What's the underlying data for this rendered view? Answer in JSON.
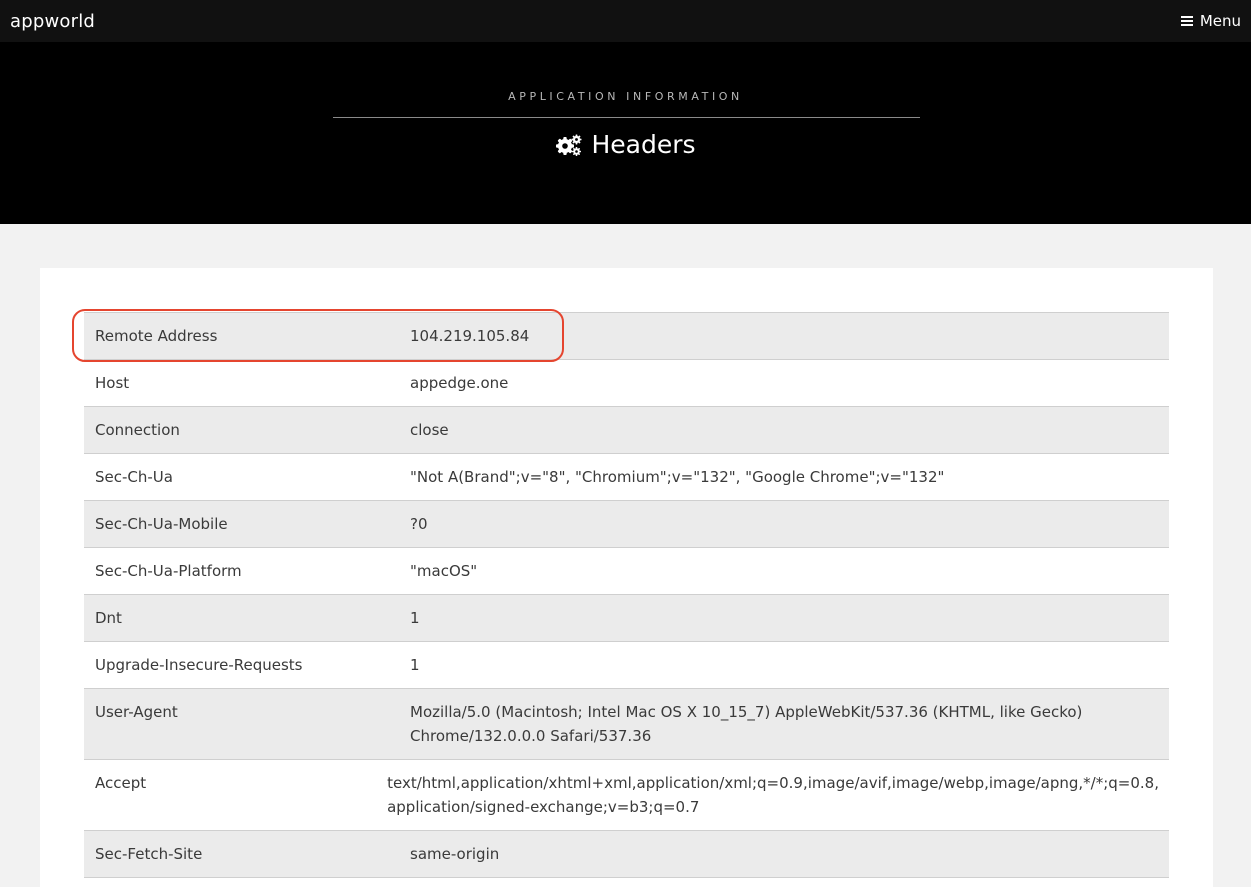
{
  "topbar": {
    "logo": "appworld",
    "menu_label": "Menu"
  },
  "hero": {
    "eyebrow": "APPLICATION INFORMATION",
    "title": "Headers"
  },
  "headers": [
    {
      "key": "Remote Address",
      "value": "104.219.105.84"
    },
    {
      "key": "Host",
      "value": "appedge.one"
    },
    {
      "key": "Connection",
      "value": "close"
    },
    {
      "key": "Sec-Ch-Ua",
      "value": "\"Not A(Brand\";v=\"8\", \"Chromium\";v=\"132\", \"Google Chrome\";v=\"132\""
    },
    {
      "key": "Sec-Ch-Ua-Mobile",
      "value": "?0"
    },
    {
      "key": "Sec-Ch-Ua-Platform",
      "value": "\"macOS\""
    },
    {
      "key": "Dnt",
      "value": "1"
    },
    {
      "key": "Upgrade-Insecure-Requests",
      "value": "1"
    },
    {
      "key": "User-Agent",
      "value": "Mozilla/5.0 (Macintosh; Intel Mac OS X 10_15_7) AppleWebKit/537.36 (KHTML, like Gecko) Chrome/132.0.0.0 Safari/537.36"
    },
    {
      "key": "Accept",
      "value": "text/html,application/xhtml+xml,application/xml;q=0.9,image/avif,image/webp,image/apng,*/*;q=0.8, application/signed-exchange;v=b3;q=0.7"
    },
    {
      "key": "Sec-Fetch-Site",
      "value": "same-origin"
    }
  ],
  "colors": {
    "highlight": "#e5452f",
    "hero_bg": "#000000",
    "topbar_bg": "#111111"
  },
  "icons": {
    "menu": "hamburger-icon",
    "title": "gears-icon"
  }
}
